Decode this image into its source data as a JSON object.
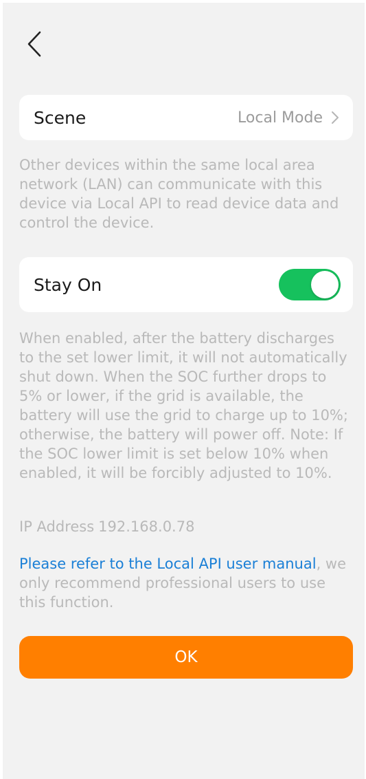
{
  "header": {
    "back_icon": "chevron-left-icon"
  },
  "scene": {
    "label": "Scene",
    "value": "Local Mode",
    "chevron_icon": "chevron-right-icon"
  },
  "local_api_description": "Other devices within the same local area network (LAN) can communicate with this device via Local API to read device data and control the device.",
  "stay_on": {
    "label": "Stay On",
    "enabled": true,
    "toggle_color": "#16c15d",
    "description": "When enabled, after the battery discharges to the set lower limit, it will not automatically shut down. When the SOC further drops to 5% or lower, if the grid is available, the battery will use the grid to charge up to 10%; otherwise, the battery will power off. Note: If the SOC lower limit is set below 10% when enabled, it will be forcibly adjusted to 10%."
  },
  "ip": {
    "label": "IP Address",
    "value": "192.168.0.78"
  },
  "manual": {
    "link_text": "Please refer to the Local API user manual",
    "rest_text": ", we only recommend professional users to use this function.",
    "link_color": "#1a7fd6"
  },
  "ok_button": {
    "label": "OK",
    "color": "#ff7f00"
  }
}
